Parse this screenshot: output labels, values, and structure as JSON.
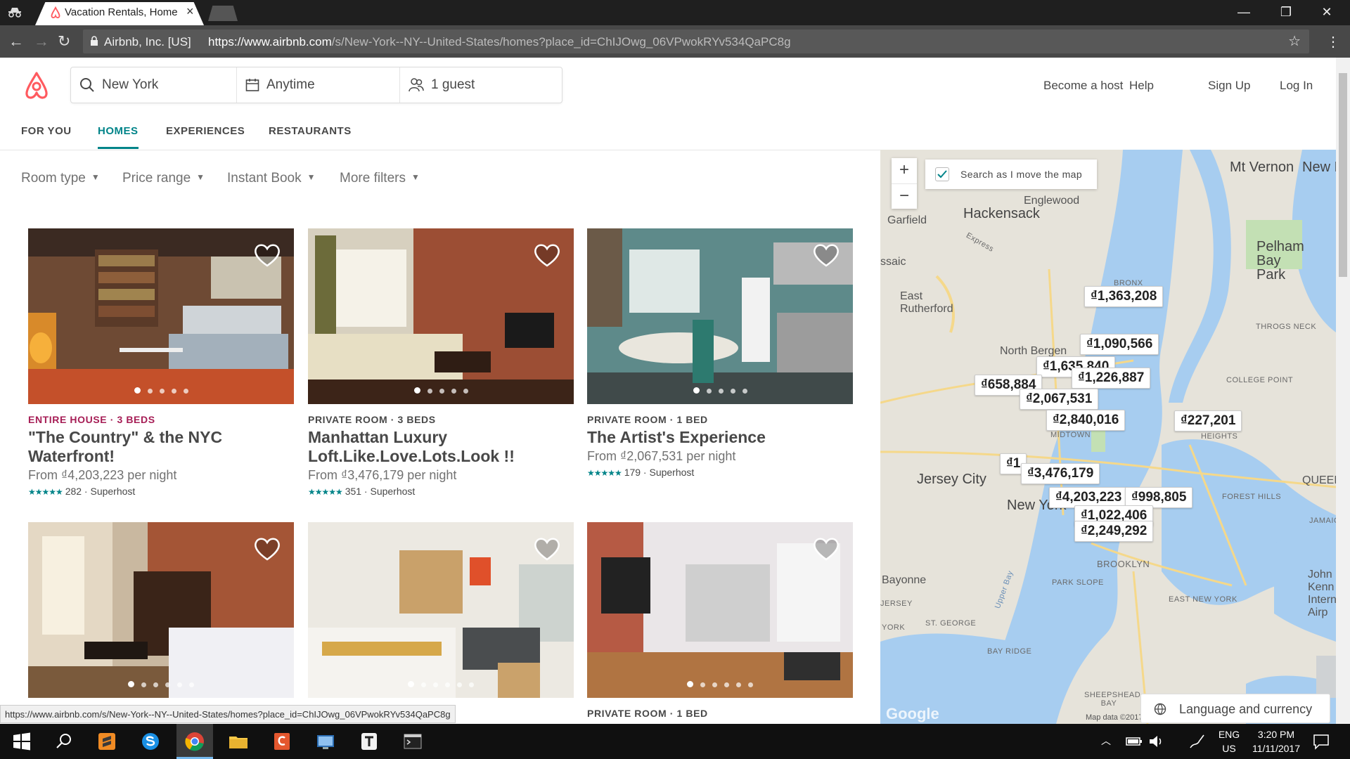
{
  "browser": {
    "tab_title": "Vacation Rentals, Homes",
    "tab_close": "×",
    "site_identity": "Airbnb, Inc. [US]",
    "url_base": "https://www.airbnb.com",
    "url_path": "/s/New-York--NY--United-States/homes?place_id=ChIJOwg_06VPwokRYv534QaPC8g",
    "status_url": "https://www.airbnb.com/s/New-York--NY--United-States/homes?place_id=ChIJOwg_06VPwokRYv534QaPC8g",
    "window": {
      "minimize": "—",
      "restore": "❐",
      "close": "✕"
    }
  },
  "search": {
    "location": "New York",
    "dates": "Anytime",
    "guests": "1 guest"
  },
  "header_links": [
    "Become a host",
    "Help",
    "Sign Up",
    "Log In"
  ],
  "subnav": [
    "FOR YOU",
    "HOMES",
    "EXPERIENCES",
    "RESTAURANTS"
  ],
  "filters": [
    "Room type",
    "Price range",
    "Instant Book",
    "More filters"
  ],
  "listings": [
    {
      "kicker": "ENTIRE HOUSE · 3 BEDS",
      "kicker_color": "#a61d55",
      "title_lines": [
        "\"The Country\" & the NYC",
        "Waterfront!"
      ],
      "price": "From ₫4,203,223  per night",
      "stars": "★★★★★",
      "reviews": "282 · Superhost"
    },
    {
      "kicker": "PRIVATE ROOM · 3 BEDS",
      "kicker_color": "#484848",
      "title_lines": [
        "Manhattan Luxury",
        "Loft.Like.Love.Lots.Look !!"
      ],
      "price": "From ₫3,476,179  per night",
      "stars": "★★★★★",
      "reviews": "351 · Superhost"
    },
    {
      "kicker": "PRIVATE ROOM · 1 BED",
      "kicker_color": "#484848",
      "title_lines": [
        "The Artist's Experience",
        ""
      ],
      "price": "From ₫2,067,531  per night",
      "stars": "★★★★★",
      "reviews": "179 · Superhost"
    },
    {
      "kicker": "",
      "kicker_color": "#484848",
      "title_lines": [
        "",
        ""
      ],
      "price": "",
      "stars": "",
      "reviews": ""
    },
    {
      "kicker": "",
      "kicker_color": "#484848",
      "title_lines": [
        "",
        ""
      ],
      "price": "",
      "stars": "",
      "reviews": ""
    },
    {
      "kicker": "PRIVATE ROOM · 1 BED",
      "kicker_color": "#484848",
      "title_lines": [
        "",
        ""
      ],
      "price": "",
      "stars": "",
      "reviews": ""
    }
  ],
  "map": {
    "search_toggle": "Search as I move the map",
    "zoom_in": "+",
    "zoom_out": "−",
    "pins": [
      "₫1,363,208",
      "₫1,090,566",
      "₫1,635,840",
      "₫1,226,887",
      "₫658,884",
      "₫2,067,531",
      "₫2,840,016",
      "₫227,201",
      "₫1",
      "₫3,476,179",
      "₫4,203,223",
      "₫998,805",
      "₫1,022,406",
      "₫2,249,292"
    ],
    "labels": [
      "Mt Vernon",
      "New Ro",
      "Englewood",
      "Hackensack",
      "Garfield",
      "ssaic",
      "East Rutherford",
      "North Bergen",
      "Pelham Bay Park",
      "BRONX",
      "THROGS NECK",
      "COLLEGE POINT",
      "QUEENS",
      "FOREST HILLS",
      "JAMAICA",
      "Jersey City",
      "New York",
      "BROOKLYN",
      "PARK SLOPE",
      "EAST NEW YORK",
      "Bayonne",
      "ST. GEORGE",
      "BAY RIDGE",
      "SHEEPSHEAD BAY",
      "Upper Bay",
      "Google",
      "Map data ©2017",
      "HEIGHTS",
      "MIDTOWN",
      "John Kenn Interna Airp",
      "Express",
      "JERSEY",
      "YORK"
    ],
    "language_button": "Language and currency"
  },
  "taskbar": {
    "lang_top": "ENG",
    "lang_bottom": "US",
    "time": "3:20 PM",
    "date": "11/11/2017"
  },
  "colors": {
    "accent": "#008489",
    "brand": "#ff5a5f",
    "rausch_kicker": "#a61d55"
  }
}
